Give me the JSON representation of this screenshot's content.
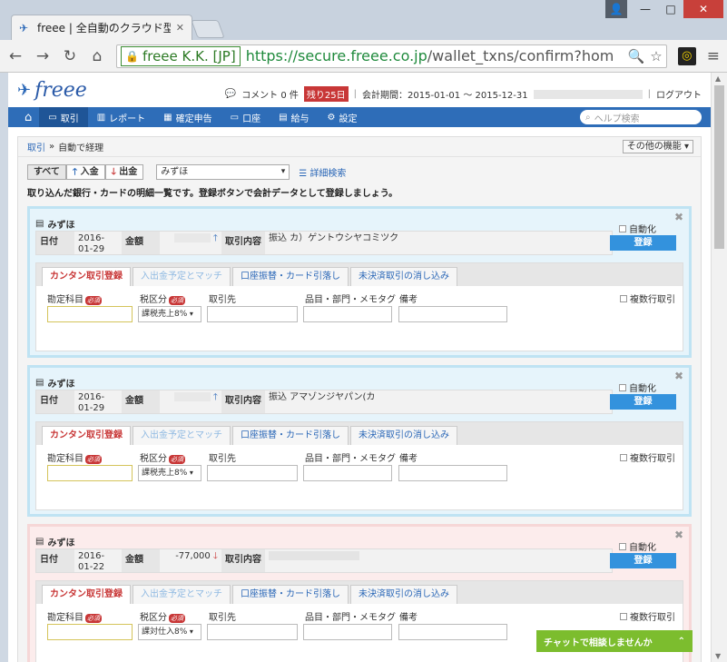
{
  "browser": {
    "tab_title": "freee | 全自動のクラウド型",
    "ev_label": "freee K.K. [JP]",
    "url_host": "https://secure.freee.co.jp",
    "url_path": "/wallet_txns/confirm?hom"
  },
  "header": {
    "logo_text": "freee",
    "comment": "コメント 0 件",
    "days_left": "残り25日",
    "period": "会計期間：2015-01-01 ～ 2015-12-31",
    "logout": "ログアウト"
  },
  "nav": {
    "items": [
      "取引",
      "レポート",
      "確定申告",
      "口座",
      "給与",
      "設定"
    ],
    "help_placeholder": "ヘルプ検索"
  },
  "breadcrumb": {
    "root": "取引",
    "sep": "»",
    "current": "自動で経理"
  },
  "other_features": "その他の機能",
  "filters": {
    "all": "すべて",
    "income": "入金",
    "expense": "出金",
    "bank": "みずほ",
    "detail_search": "詳細検索"
  },
  "description": "取り込んだ銀行・カードの明細一覧です。登録ボタンで会計データとして登録しましょう。",
  "labels": {
    "date": "日付",
    "amount": "金額",
    "content": "取引内容",
    "auto": "自動化",
    "register": "登録",
    "account": "勘定科目",
    "tax": "税区分",
    "partner": "取引先",
    "item": "品目・部門・メモタグ",
    "note": "備考",
    "multi": "複数行取引",
    "required": "必須"
  },
  "tabs": [
    "カンタン取引登録",
    "入出金予定とマッチ",
    "口座振替・カード引落し",
    "未決済取引の消し込み"
  ],
  "cards": [
    {
      "bank": "みずほ",
      "date": "2016-01-29",
      "amount": "",
      "direction": "in",
      "content": "振込 カ）ゲントウシヤコミツク",
      "tax": "課税売上8%"
    },
    {
      "bank": "みずほ",
      "date": "2016-01-29",
      "amount": "",
      "direction": "in",
      "content": "振込 アマゾンジヤパン(カ",
      "tax": "課税売上8%"
    },
    {
      "bank": "みずほ",
      "date": "2016-01-22",
      "amount": "-77,000",
      "direction": "out",
      "content": "",
      "tax": "課対仕入8%"
    }
  ],
  "chat": "チャットで相談しませんか",
  "colors": {
    "nav_blue": "#2e6db8",
    "register_blue": "#3392dd",
    "income_card": "#e6f4fb",
    "expense_card": "#fcecec",
    "chat_green": "#7cbd2e"
  }
}
